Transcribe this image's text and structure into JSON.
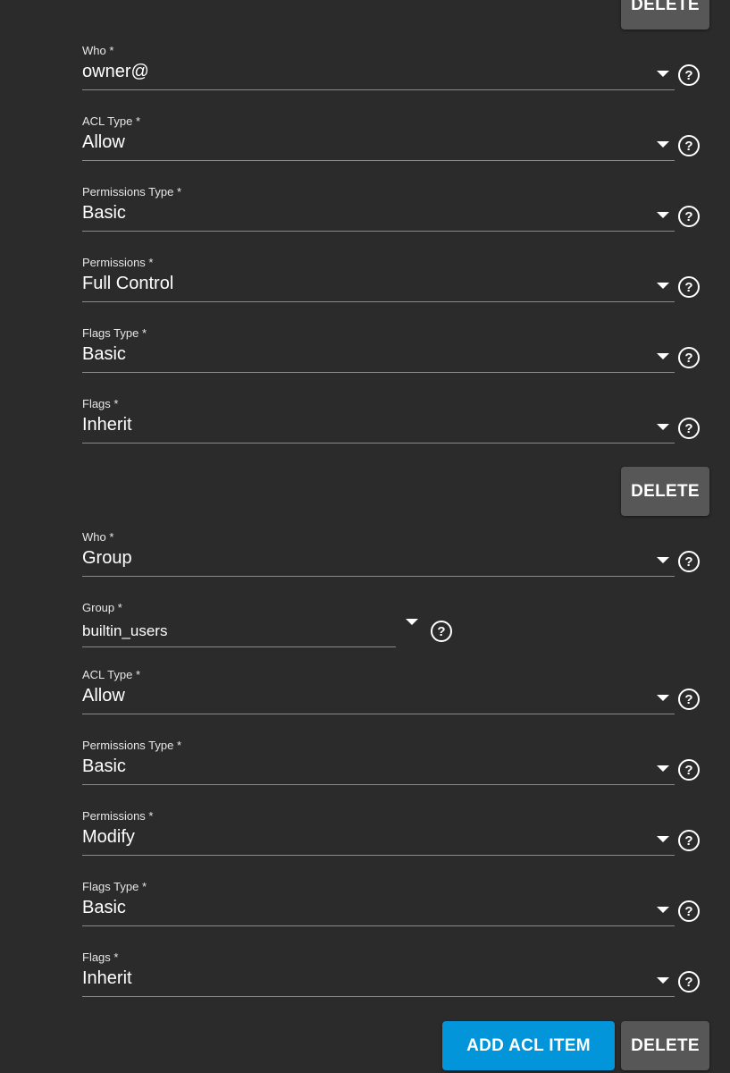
{
  "buttons": {
    "delete": "DELETE",
    "add_acl_item": "ADD ACL ITEM"
  },
  "entries": [
    {
      "fields": [
        {
          "label": "Who *",
          "value": "owner@"
        },
        {
          "label": "ACL Type *",
          "value": "Allow"
        },
        {
          "label": "Permissions Type *",
          "value": "Basic"
        },
        {
          "label": "Permissions *",
          "value": "Full Control"
        },
        {
          "label": "Flags Type *",
          "value": "Basic"
        },
        {
          "label": "Flags *",
          "value": "Inherit"
        }
      ]
    },
    {
      "fields": [
        {
          "label": "Who *",
          "value": "Group"
        },
        {
          "label": "Group *",
          "value": "builtin_users"
        },
        {
          "label": "ACL Type *",
          "value": "Allow"
        },
        {
          "label": "Permissions Type *",
          "value": "Basic"
        },
        {
          "label": "Permissions *",
          "value": "Modify"
        },
        {
          "label": "Flags Type *",
          "value": "Basic"
        },
        {
          "label": "Flags *",
          "value": "Inherit"
        }
      ]
    }
  ],
  "icons": {
    "help": "help-circle-icon",
    "dropdown": "caret-down-icon"
  },
  "colors": {
    "background": "#2b2b2b",
    "delete_button": "#575757",
    "add_button": "#0395d9"
  }
}
